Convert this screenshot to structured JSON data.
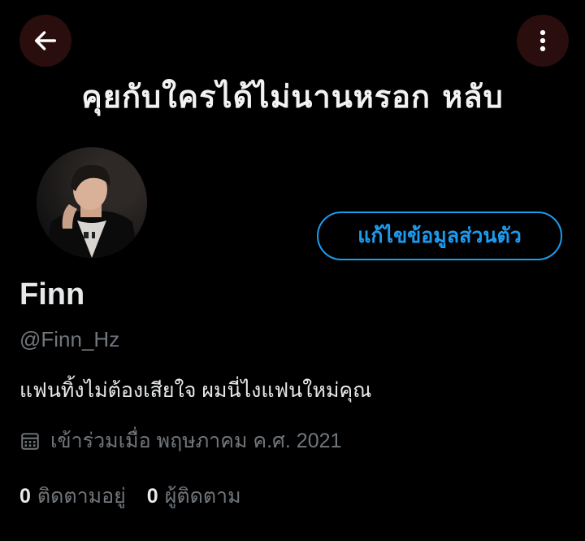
{
  "header": {
    "banner_text": "คุยกับใครได้ไม่นานหรอก หลับ",
    "back_icon": "arrow-left-icon",
    "more_icon": "more-vertical-icon",
    "button_bg": "#2a0d0d"
  },
  "profile": {
    "display_name": "Finn",
    "handle": "@Finn_Hz",
    "bio": "แฟนทิ้งไม่ต้องเสียใจ ผมนี่ไงแฟนใหม่คุณ",
    "joined": "เข้าร่วมเมื่อ พฤษภาคม ค.ศ. 2021",
    "joined_icon": "calendar-icon",
    "edit_button_label": "แก้ไขข้อมูลส่วนตัว",
    "accent": "#1d9bf0"
  },
  "stats": {
    "following_count": "0",
    "following_label": "ติดตามอยู่",
    "followers_count": "0",
    "followers_label": "ผู้ติดตาม"
  }
}
